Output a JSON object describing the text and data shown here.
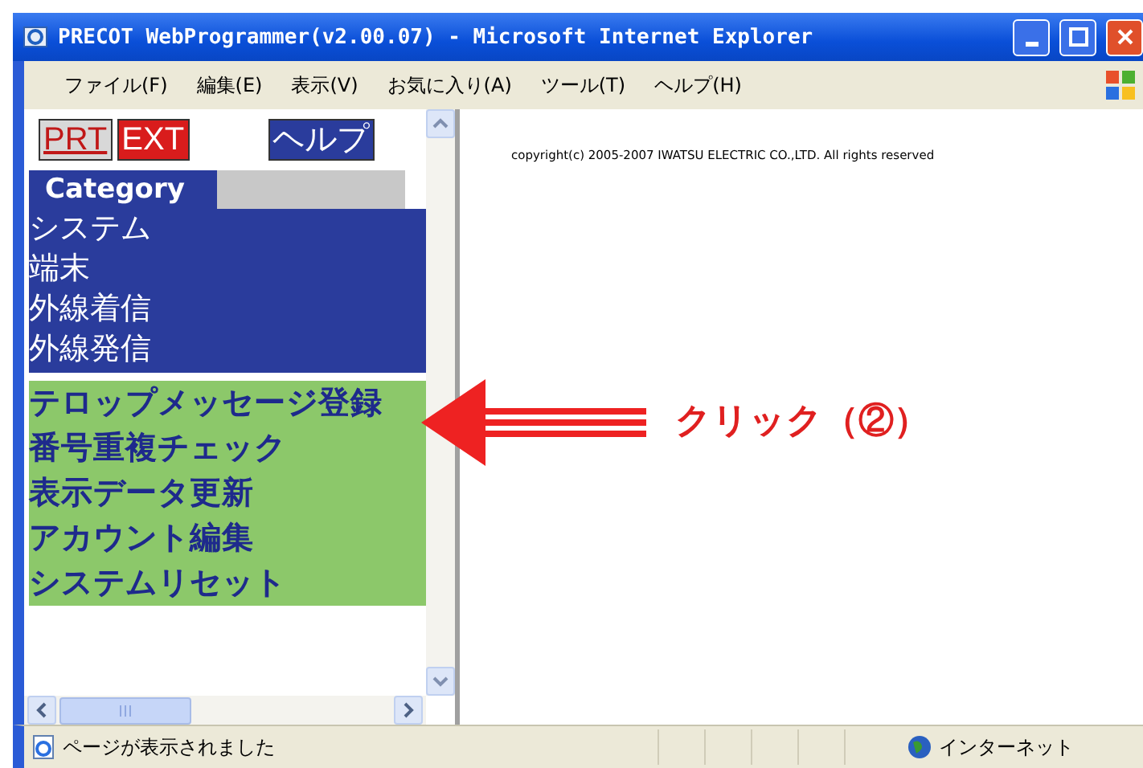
{
  "window": {
    "title": "PRECOT WebProgrammer(v2.00.07) - Microsoft Internet Explorer"
  },
  "menu": [
    "ファイル(F)",
    "編集(E)",
    "表示(V)",
    "お気に入り(A)",
    "ツール(T)",
    "ヘルプ(H)"
  ],
  "buttons": [
    {
      "kind": "print",
      "label": "PRT"
    },
    {
      "kind": "exit",
      "label": "EXT"
    },
    {
      "kind": "help",
      "label": "ヘルプ"
    }
  ],
  "category": {
    "label": "Category"
  },
  "categories": [
    "システム",
    "端末",
    "外線着信",
    "外線発信"
  ],
  "actions": [
    "テロップメッセージ登録",
    "番号重複チェック",
    "表示データ更新",
    "アカウント編集",
    "システムリセット"
  ],
  "copyright": "copyright(c) 2005-2007 IWATSU ELECTRIC CO.,LTD. All rights reserved",
  "annotation": "クリック（②）",
  "status_bar": {
    "message": "ページが表示されました",
    "zone": "インターネット"
  }
}
